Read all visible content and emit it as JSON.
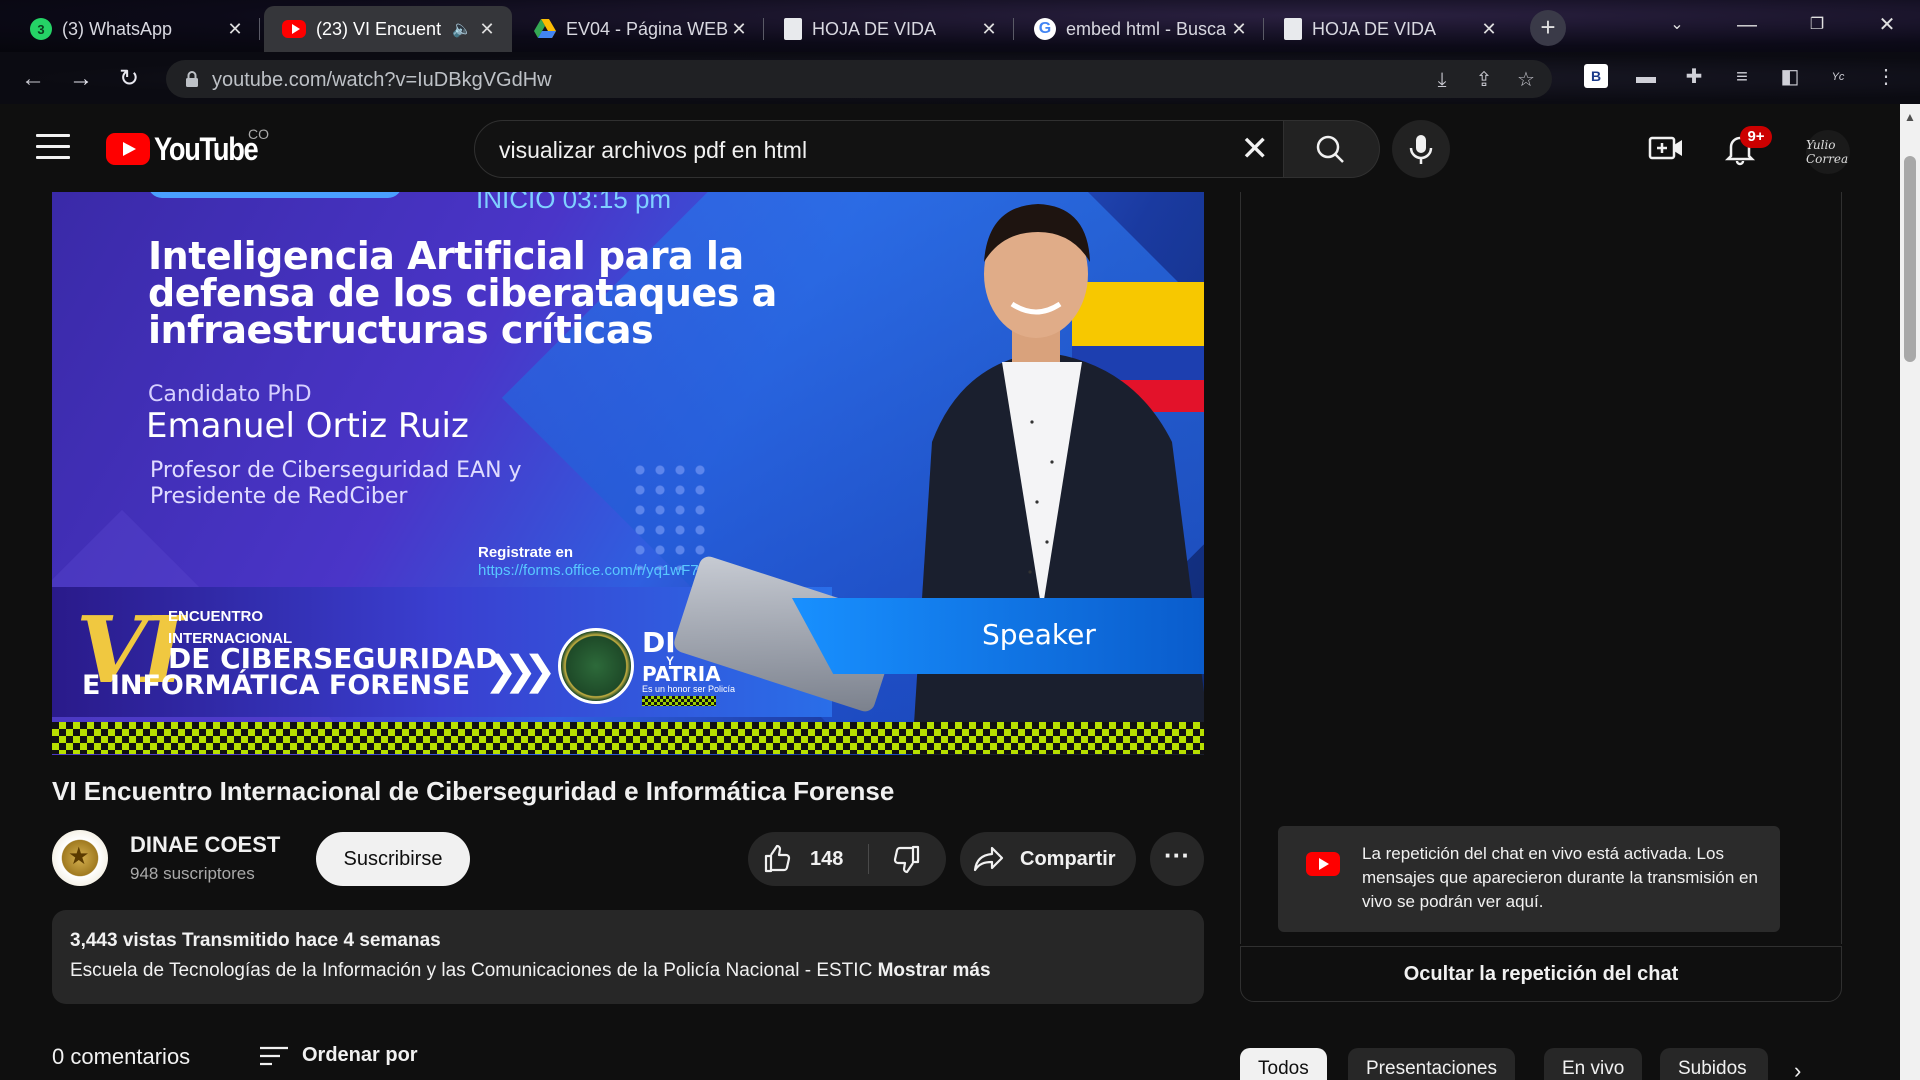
{
  "browser": {
    "tabs": [
      {
        "title": "(3) WhatsApp",
        "favicon": "whatsapp-icon",
        "favicon_color": "#25d366"
      },
      {
        "title": "(23) VI Encuent",
        "favicon": "youtube-icon",
        "favicon_color": "#ff0000"
      },
      {
        "title": "EV04 - Página WEB",
        "favicon": "google-drive-icon",
        "favicon_color": "#34a853"
      },
      {
        "title": "HOJA DE VIDA",
        "favicon": "document-icon",
        "favicon_color": "#e8eaed"
      },
      {
        "title": "embed html - Busca",
        "favicon": "google-icon",
        "favicon_color": "#4285f4"
      },
      {
        "title": "HOJA DE VIDA",
        "favicon": "document-icon",
        "favicon_color": "#e8eaed"
      }
    ],
    "active_tab_index": 1,
    "url": "youtube.com/watch?v=IuDBkgVGdHw",
    "extension_badge": "B"
  },
  "youtube": {
    "logo_text": "YouTube",
    "country_code": "CO",
    "search_query": "visualizar archivos pdf en html",
    "notification_badge": "9+",
    "avatar_text": "Yulio Correa",
    "accent_color": "#ff0000"
  },
  "thumbnail": {
    "start_time": "INICIO 03:15 pm",
    "headline": "Inteligencia Artificial para la defensa de los ciberataques a infraestructuras críticas",
    "candidate_label": "Candidato PhD",
    "speaker_name": "Emanuel Ortiz Ruiz",
    "speaker_role": "Profesor de Ciberseguridad EAN y Presidente de RedCiber",
    "register_label": "Registrate en",
    "register_link": "https://forms.office.com/r/yq1wF7v1nt",
    "event_number": "VI",
    "event_line1": "ENCUENTRO",
    "event_line2": "INTERNACIONAL",
    "event_line3": "DE CIBERSEGURIDAD",
    "event_line4": "E INFORMÁTICA FORENSE",
    "motto_word1": "DIOS",
    "motto_y": "Y",
    "motto_word2": "PATRIA",
    "motto_tagline": "Es un honor ser Policía",
    "speaker_tag": "Speaker"
  },
  "video": {
    "title": "VI Encuentro Internacional de Ciberseguridad e Informática Forense",
    "channel_name": "DINAE COEST",
    "subscribers": "948 suscriptores",
    "subscribe_label": "Suscribirse",
    "likes": "148",
    "share_label": "Compartir",
    "more_label": "···",
    "views_line": "3,443 vistas  Transmitido hace 4 semanas",
    "description": "Escuela de Tecnologías de la Información y las Comunicaciones de la Policía Nacional - ESTIC ",
    "show_more": "Mostrar más",
    "comments_count": "0 comentarios",
    "sort_label": "Ordenar por"
  },
  "chat": {
    "notice": "La repetición del chat en vivo está activada. Los mensajes que aparecieron durante la transmisión en vivo se podrán ver aquí.",
    "hide_label": "Ocultar la repetición del chat"
  },
  "chips": [
    {
      "label": "Todos",
      "active": true
    },
    {
      "label": "Presentaciones",
      "active": false
    },
    {
      "label": "En vivo",
      "active": false
    },
    {
      "label": "Subidos",
      "active": false
    }
  ]
}
